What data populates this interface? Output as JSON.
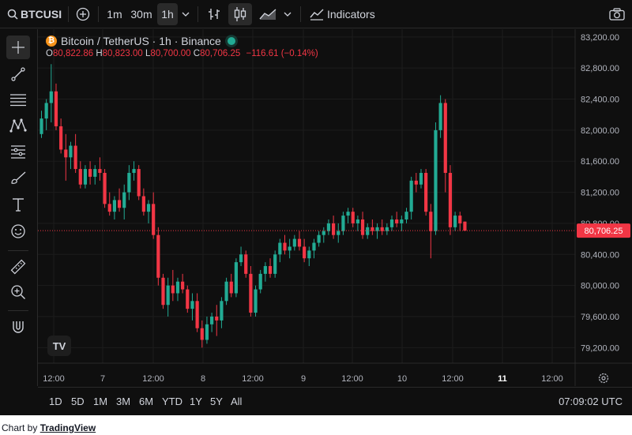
{
  "topbar": {
    "symbol": "BTCUSI",
    "intervals": [
      "1m",
      "30m",
      "1h"
    ],
    "active_interval": "1h",
    "indicators_label": "Indicators",
    "icons": [
      "search-icon",
      "add-compare-icon",
      "chevron-down-icon",
      "bar-chart-icon",
      "candlestick-icon",
      "area-chart-icon",
      "indicators-icon",
      "camera-icon"
    ]
  },
  "legend": {
    "title": "Bitcoin / TetherUS · 1h · Binance",
    "coin_glyph": "₿",
    "o_label": "O",
    "o_value": "80,822.86",
    "h_label": "H",
    "h_value": "80,823.00",
    "l_label": "L",
    "l_value": "80,700.00",
    "c_label": "C",
    "c_value": "80,706.25",
    "change": "−116.61 (−0.14%)"
  },
  "sidebar": {
    "tools": [
      "crosshair-icon",
      "trendline-icon",
      "horizontal-lines-icon",
      "pattern-icon",
      "fib-icon",
      "brush-icon",
      "text-icon",
      "emoji-icon",
      "ruler-icon",
      "zoom-icon",
      "magnet-icon"
    ]
  },
  "price_axis": {
    "labels": [
      "83,200.00",
      "82,800.00",
      "82,400.00",
      "82,000.00",
      "81,600.00",
      "81,200.00",
      "80,800.00",
      "80,400.00",
      "80,000.00",
      "79,600.00",
      "79,200.00"
    ],
    "current_price": "80,706.25"
  },
  "time_axis": {
    "labels": [
      "12:00",
      "7",
      "12:00",
      "8",
      "12:00",
      "9",
      "12:00",
      "10",
      "12:00",
      "11",
      "12:00"
    ]
  },
  "ranges": [
    "1D",
    "5D",
    "1M",
    "3M",
    "6M",
    "YTD",
    "1Y",
    "5Y",
    "All"
  ],
  "clock": "07:09:02 UTC",
  "watermark": "TV",
  "credit": {
    "prefix": "Chart by",
    "link": "TradingView"
  },
  "colors": {
    "up": "#22ab94",
    "down": "#f23645",
    "background": "#0f0f0f",
    "grid": "#1c1c1c",
    "text": "#d1d4dc"
  },
  "chart_data": {
    "type": "candlestick",
    "title": "Bitcoin / TetherUS · 1h · Binance",
    "ylim": [
      79000,
      83300
    ],
    "y_ticks": [
      83200,
      82800,
      82400,
      82000,
      81600,
      81200,
      80800,
      80400,
      80000,
      79600,
      79200
    ],
    "x_ticks": [
      "12:00",
      "7",
      "12:00",
      "8",
      "12:00",
      "9",
      "12:00",
      "10",
      "12:00",
      "11",
      "12:00"
    ],
    "last_close": 80706.25,
    "grid": true,
    "candles": [
      [
        81950,
        82250,
        81900,
        82150
      ],
      [
        82150,
        82400,
        82000,
        82350
      ],
      [
        82350,
        82850,
        82100,
        82500
      ],
      [
        82500,
        82600,
        82000,
        82050
      ],
      [
        82050,
        82150,
        81700,
        81750
      ],
      [
        81750,
        81950,
        81350,
        81650
      ],
      [
        81650,
        81850,
        81500,
        81800
      ],
      [
        81800,
        81950,
        81450,
        81500
      ],
      [
        81500,
        81600,
        81250,
        81300
      ],
      [
        81300,
        81550,
        81250,
        81500
      ],
      [
        81500,
        81600,
        81300,
        81400
      ],
      [
        81400,
        81550,
        81300,
        81500
      ],
      [
        81500,
        81650,
        81350,
        81450
      ],
      [
        81450,
        81500,
        81000,
        81050
      ],
      [
        81050,
        81200,
        80900,
        80950
      ],
      [
        80950,
        81150,
        80850,
        81100
      ],
      [
        81100,
        81250,
        80950,
        81000
      ],
      [
        81000,
        81300,
        80850,
        81200
      ],
      [
        81200,
        81550,
        81100,
        81450
      ],
      [
        81450,
        81600,
        81350,
        81500
      ],
      [
        81500,
        81550,
        81100,
        81150
      ],
      [
        81150,
        81250,
        80900,
        80950
      ],
      [
        80950,
        81100,
        80800,
        81050
      ],
      [
        81050,
        81200,
        80600,
        80650
      ],
      [
        80650,
        80750,
        80000,
        80100
      ],
      [
        80100,
        80150,
        79700,
        79750
      ],
      [
        79750,
        80100,
        79600,
        80000
      ],
      [
        80000,
        80200,
        79800,
        79900
      ],
      [
        79900,
        80100,
        79800,
        80050
      ],
      [
        80050,
        80150,
        79900,
        79950
      ],
      [
        79950,
        80000,
        79650,
        79700
      ],
      [
        79700,
        79900,
        79550,
        79800
      ],
      [
        79800,
        79900,
        79400,
        79450
      ],
      [
        79450,
        79550,
        79200,
        79300
      ],
      [
        79300,
        79600,
        79250,
        79500
      ],
      [
        79500,
        79650,
        79400,
        79600
      ],
      [
        79600,
        79750,
        79350,
        79550
      ],
      [
        79550,
        79850,
        79450,
        79800
      ],
      [
        79800,
        80100,
        79750,
        80050
      ],
      [
        80050,
        80150,
        79850,
        79900
      ],
      [
        79900,
        80350,
        79850,
        80300
      ],
      [
        80300,
        80500,
        80250,
        80400
      ],
      [
        80400,
        80450,
        80100,
        80150
      ],
      [
        80150,
        80250,
        79600,
        79650
      ],
      [
        79650,
        80000,
        79600,
        79950
      ],
      [
        79950,
        80200,
        79900,
        80150
      ],
      [
        80150,
        80300,
        80050,
        80250
      ],
      [
        80250,
        80350,
        80100,
        80150
      ],
      [
        80150,
        80450,
        80100,
        80400
      ],
      [
        80400,
        80600,
        80300,
        80550
      ],
      [
        80550,
        80650,
        80400,
        80450
      ],
      [
        80450,
        80600,
        80350,
        80500
      ],
      [
        80500,
        80650,
        80450,
        80600
      ],
      [
        80600,
        80700,
        80450,
        80500
      ],
      [
        80500,
        80600,
        80300,
        80350
      ],
      [
        80350,
        80500,
        80250,
        80450
      ],
      [
        80450,
        80600,
        80350,
        80550
      ],
      [
        80550,
        80700,
        80500,
        80650
      ],
      [
        80650,
        80750,
        80550,
        80700
      ],
      [
        80700,
        80850,
        80650,
        80800
      ],
      [
        80800,
        80900,
        80600,
        80650
      ],
      [
        80650,
        80800,
        80550,
        80700
      ],
      [
        80700,
        80950,
        80650,
        80900
      ],
      [
        80900,
        81000,
        80800,
        80950
      ],
      [
        80950,
        81000,
        80750,
        80800
      ],
      [
        80800,
        80900,
        80700,
        80850
      ],
      [
        80850,
        80950,
        80600,
        80650
      ],
      [
        80650,
        80800,
        80600,
        80750
      ],
      [
        80750,
        80850,
        80650,
        80700
      ],
      [
        80700,
        80800,
        80600,
        80750
      ],
      [
        80750,
        80850,
        80650,
        80700
      ],
      [
        80700,
        80800,
        80650,
        80750
      ],
      [
        80750,
        80900,
        80700,
        80850
      ],
      [
        80850,
        80950,
        80750,
        80800
      ],
      [
        80800,
        80900,
        80700,
        80850
      ],
      [
        80850,
        81000,
        80800,
        80950
      ],
      [
        80950,
        81400,
        80850,
        81350
      ],
      [
        81350,
        81450,
        81200,
        81300
      ],
      [
        81300,
        81500,
        81250,
        81450
      ],
      [
        81450,
        81500,
        80900,
        80950
      ],
      [
        80950,
        81050,
        80350,
        80700
      ],
      [
        80700,
        82100,
        80650,
        82000
      ],
      [
        82000,
        82450,
        81900,
        82350
      ],
      [
        82350,
        82400,
        81200,
        81450
      ],
      [
        81450,
        81550,
        80650,
        80750
      ],
      [
        80750,
        80950,
        80700,
        80900
      ],
      [
        80900,
        80950,
        80700,
        80800
      ],
      [
        80822.86,
        80823,
        80700,
        80706.25
      ]
    ]
  }
}
